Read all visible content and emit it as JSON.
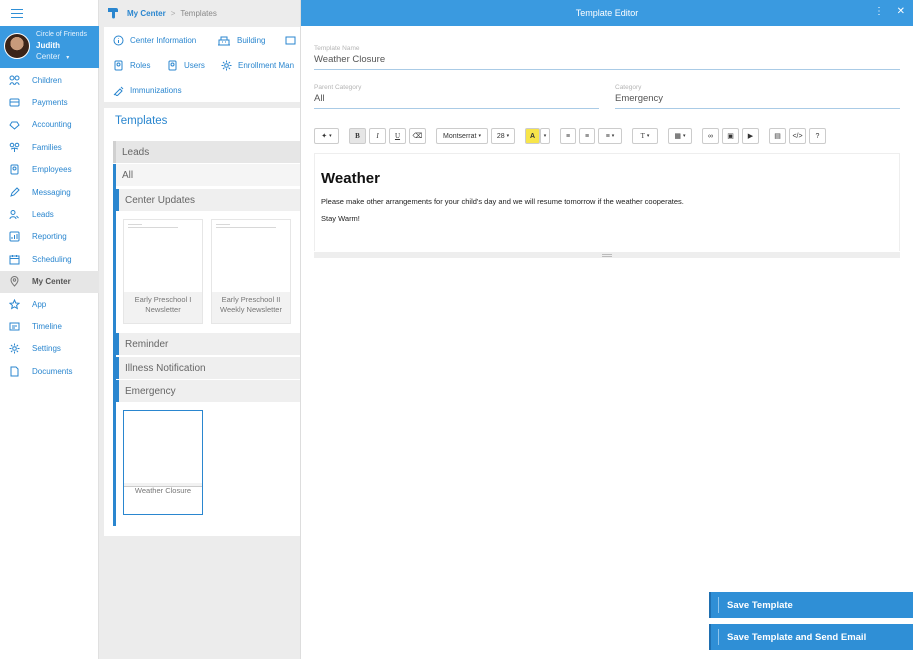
{
  "sidebar": {
    "profile": {
      "org": "Circle of Friends",
      "name": "Judith",
      "role": "Center"
    },
    "items": [
      {
        "label": "Children",
        "icon": "children-icon"
      },
      {
        "label": "Payments",
        "icon": "payments-icon"
      },
      {
        "label": "Accounting",
        "icon": "accounting-icon"
      },
      {
        "label": "Families",
        "icon": "families-icon"
      },
      {
        "label": "Employees",
        "icon": "employees-icon"
      },
      {
        "label": "Messaging",
        "icon": "messaging-icon"
      },
      {
        "label": "Leads",
        "icon": "leads-icon"
      },
      {
        "label": "Reporting",
        "icon": "reporting-icon"
      },
      {
        "label": "Scheduling",
        "icon": "scheduling-icon"
      },
      {
        "label": "My Center",
        "icon": "location-pin-icon"
      },
      {
        "label": "App",
        "icon": "star-icon"
      },
      {
        "label": "Timeline",
        "icon": "timeline-icon"
      },
      {
        "label": "Settings",
        "icon": "gear-icon"
      },
      {
        "label": "Documents",
        "icon": "document-icon"
      }
    ],
    "active": "My Center"
  },
  "breadcrumb": {
    "home": "My Center",
    "separator": ">",
    "current": "Templates"
  },
  "center_menu": {
    "center_information": "Center Information",
    "building": "Building",
    "roles": "Roles",
    "users": "Users",
    "enrollment": "Enrollment Man",
    "immunizations": "Immunizations"
  },
  "templates": {
    "title": "Templates",
    "groups": {
      "leads": "Leads",
      "all": "All",
      "center_updates": "Center Updates",
      "reminder": "Reminder",
      "illness": "Illness Notification",
      "emergency": "Emergency"
    },
    "cards": {
      "early_preschool_1": "Early Preschool I Newsletter",
      "early_preschool_2": "Early Preschool II Weekly Newsletter",
      "weather_closure": "Weather Closure"
    }
  },
  "editor": {
    "title": "Template Editor",
    "template_name_label": "Template Name",
    "template_name": "Weather Closure",
    "parent_category_label": "Parent Category",
    "parent_category": "All",
    "category_label": "Category",
    "category": "Emergency",
    "toolbar": {
      "font": "Montserrat",
      "size": "28",
      "highlight": "A",
      "bold": "B",
      "italic": "I",
      "underline": "U",
      "text_style": "T",
      "code": "</>",
      "help": "?"
    },
    "content": {
      "heading": "Weather",
      "paragraph1": "Please make other arrangements for your child's day and we will resume tomorrow if the weather cooperates.",
      "paragraph2": "Stay Warm!"
    },
    "save_button": "Save Template",
    "save_send_button": "Save Template and Send Email"
  },
  "colors": {
    "accent": "#3a9ae0",
    "link": "#2a86cf",
    "highlight": "#f7e54a"
  }
}
